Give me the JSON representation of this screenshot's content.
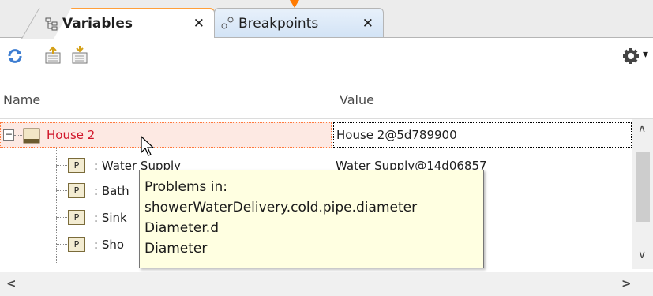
{
  "tabs": {
    "variables": {
      "label": "Variables",
      "close": "✕",
      "icon": "variables-icon"
    },
    "breakpoints": {
      "label": "Breakpoints",
      "close": "✕",
      "icon": "breakpoints-icon"
    }
  },
  "toolbar": {
    "buttons": [
      "refresh-icon",
      "export-icon",
      "import-icon"
    ],
    "settings_icon": "gear-icon",
    "menu_arrow": "▾"
  },
  "columns": {
    "name": "Name",
    "value": "Value"
  },
  "rows": [
    {
      "name": "House 2",
      "value": "House 2@5d789900",
      "expanded": true,
      "selected": true
    },
    {
      "name": ": Water Supply",
      "value": "Water Supply@14d06857"
    },
    {
      "name": ": Bath",
      "value": ""
    },
    {
      "name": ": Sink",
      "value": ""
    },
    {
      "name": ": Sho",
      "value": ""
    }
  ],
  "tree": {
    "expander": "−",
    "part_badge": "P"
  },
  "tooltip": {
    "lines": [
      "Problems in:",
      "showerWaterDelivery.cold.pipe.diameter",
      "Diameter.d",
      "Diameter"
    ]
  },
  "scroll": {
    "up": "∧",
    "down": "∨",
    "left": "<",
    "right": ">"
  },
  "colors": {
    "selected_text": "#d0152a",
    "tooltip_bg": "#ffffe1",
    "active_tab_accent": "#ff9f3a"
  }
}
